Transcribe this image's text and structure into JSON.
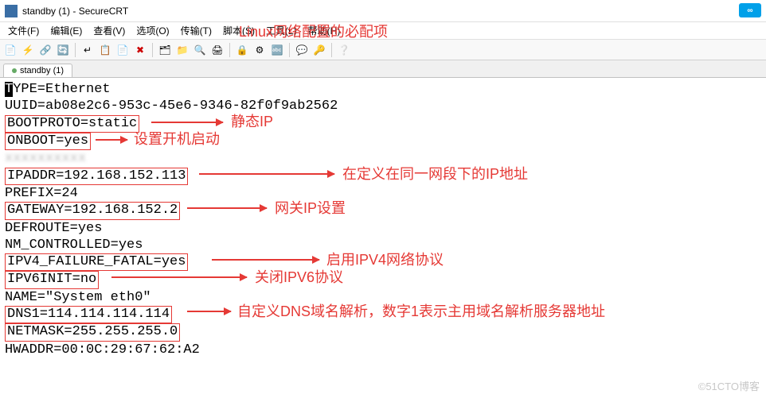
{
  "window": {
    "title": "standby (1) - SecureCRT",
    "cloud_badge": "∞"
  },
  "menu": {
    "file": "文件(F)",
    "edit": "编辑(E)",
    "view": "查看(V)",
    "options": "选项(O)",
    "transfer": "传输(T)",
    "script": "脚本(S)",
    "tools": "工具(L)",
    "help": "帮助(H)"
  },
  "tab": {
    "label": "standby (1)"
  },
  "terminal": {
    "l1_inv": "T",
    "l1_rest": "YPE=Ethernet",
    "l2": "UUID=ab08e2c6-953c-45e6-9346-82f0f9ab2562",
    "l3": "BOOTPROTO=static",
    "l4": "ONBOOT=yes",
    "l5": "IPADDR=192.168.152.113",
    "l6": "PREFIX=24",
    "l7": "GATEWAY=192.168.152.2",
    "l8": "DEFROUTE=yes",
    "l9": "NM_CONTROLLED=yes",
    "l10": "IPV4_FAILURE_FATAL=yes",
    "l11": "IPV6INIT=no",
    "l12": "NAME=\"System eth0\"",
    "l13": "DNS1=114.114.114.114",
    "l14": "NETMASK=255.255.255.0",
    "l15": "HWADDR=00:0C:29:67:62:A2"
  },
  "annotations": {
    "title_note": "Linux网络配置的必配项",
    "a_static": "静态IP",
    "a_onboot": "设置开机启动",
    "a_ipaddr": "在定义在同一网段下的IP地址",
    "a_gateway": "网关IP设置",
    "a_ipv4": "启用IPV4网络协议",
    "a_ipv6": "关闭IPV6协议",
    "a_dns": "自定义DNS域名解析，数字1表示主用域名解析服务器地址"
  },
  "watermark": "©51CTO博客"
}
